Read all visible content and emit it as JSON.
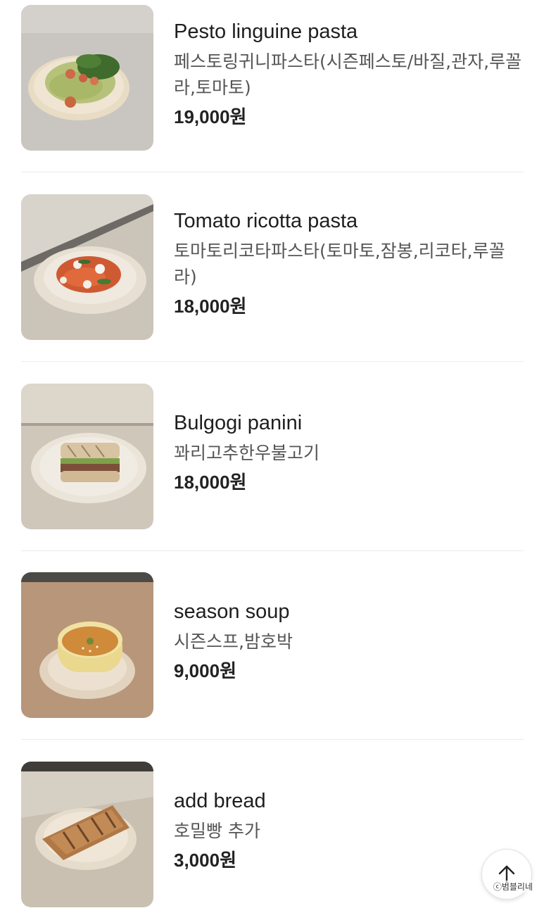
{
  "menu": {
    "items": [
      {
        "name": "Pesto linguine pasta",
        "desc": "페스토링귀니파스타(시즌페스토/바질,관자,루꼴라,토마토)",
        "price": "19,000",
        "currency": "원"
      },
      {
        "name": "Tomato ricotta pasta",
        "desc": "토마토리코타파스타(토마토,잠봉,리코타,루꼴라)",
        "price": "18,000",
        "currency": "원"
      },
      {
        "name": "Bulgogi panini",
        "desc": "꽈리고추한우불고기",
        "price": "18,000",
        "currency": "원"
      },
      {
        "name": "season soup",
        "desc": "시즌스프,밤호박",
        "price": "9,000",
        "currency": "원"
      },
      {
        "name": "add bread",
        "desc": "호밀빵 추가",
        "price": "3,000",
        "currency": "원"
      }
    ]
  },
  "scroll_top": {
    "icon": "arrow-up-icon"
  },
  "watermark": "ⓒ범블리네"
}
